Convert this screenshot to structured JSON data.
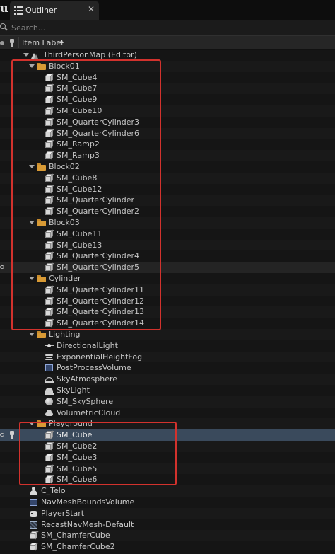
{
  "tab": {
    "title": "Outliner",
    "close": "✕"
  },
  "search": {
    "placeholder": "Search..."
  },
  "header": {
    "column_label": "Item Label"
  },
  "colors": {
    "highlight": "#d2322d",
    "selected_row": "#3a4a5c",
    "folder": "#d89a35"
  },
  "rows": [
    {
      "label": "ThirdPersonMap (Editor)",
      "icon": "map-icon",
      "expanded": true
    },
    {
      "label": "Block01",
      "icon": "folder-icon",
      "expanded": true
    },
    {
      "label": "SM_Cube4",
      "icon": "static-mesh-icon"
    },
    {
      "label": "SM_Cube7",
      "icon": "static-mesh-icon"
    },
    {
      "label": "SM_Cube9",
      "icon": "static-mesh-icon"
    },
    {
      "label": "SM_Cube10",
      "icon": "static-mesh-icon"
    },
    {
      "label": "SM_QuarterCylinder3",
      "icon": "static-mesh-icon"
    },
    {
      "label": "SM_QuarterCylinder6",
      "icon": "static-mesh-icon"
    },
    {
      "label": "SM_Ramp2",
      "icon": "static-mesh-icon"
    },
    {
      "label": "SM_Ramp3",
      "icon": "static-mesh-icon"
    },
    {
      "label": "Block02",
      "icon": "folder-icon",
      "expanded": true
    },
    {
      "label": "SM_Cube8",
      "icon": "static-mesh-icon"
    },
    {
      "label": "SM_Cube12",
      "icon": "static-mesh-icon"
    },
    {
      "label": "SM_QuarterCylinder",
      "icon": "static-mesh-icon"
    },
    {
      "label": "SM_QuarterCylinder2",
      "icon": "static-mesh-icon"
    },
    {
      "label": "Block03",
      "icon": "folder-icon",
      "expanded": true
    },
    {
      "label": "SM_Cube11",
      "icon": "static-mesh-icon"
    },
    {
      "label": "SM_Cube13",
      "icon": "static-mesh-icon"
    },
    {
      "label": "SM_QuarterCylinder4",
      "icon": "static-mesh-icon"
    },
    {
      "label": "SM_QuarterCylinder5",
      "icon": "static-mesh-icon",
      "state": "hover"
    },
    {
      "label": "Cylinder",
      "icon": "folder-icon",
      "expanded": true
    },
    {
      "label": "SM_QuarterCylinder11",
      "icon": "static-mesh-icon"
    },
    {
      "label": "SM_QuarterCylinder12",
      "icon": "static-mesh-icon"
    },
    {
      "label": "SM_QuarterCylinder13",
      "icon": "static-mesh-icon"
    },
    {
      "label": "SM_QuarterCylinder14",
      "icon": "static-mesh-icon"
    },
    {
      "label": "Lighting",
      "icon": "folder-icon",
      "expanded": true
    },
    {
      "label": "DirectionalLight",
      "icon": "directional-light-icon"
    },
    {
      "label": "ExponentialHeightFog",
      "icon": "fog-icon"
    },
    {
      "label": "PostProcessVolume",
      "icon": "volume-icon"
    },
    {
      "label": "SkyAtmosphere",
      "icon": "sky-atmosphere-icon"
    },
    {
      "label": "SkyLight",
      "icon": "sky-light-icon"
    },
    {
      "label": "SM_SkySphere",
      "icon": "sphere-icon"
    },
    {
      "label": "VolumetricCloud",
      "icon": "cloud-icon"
    },
    {
      "label": "Playground",
      "icon": "folder-icon",
      "expanded": true
    },
    {
      "label": "SM_Cube",
      "icon": "static-mesh-icon",
      "state": "selected"
    },
    {
      "label": "SM_Cube2",
      "icon": "static-mesh-icon"
    },
    {
      "label": "SM_Cube3",
      "icon": "static-mesh-icon"
    },
    {
      "label": "SM_Cube5",
      "icon": "static-mesh-icon"
    },
    {
      "label": "SM_Cube6",
      "icon": "static-mesh-icon"
    },
    {
      "label": "C_Telo",
      "icon": "character-icon"
    },
    {
      "label": "NavMeshBoundsVolume",
      "icon": "navmesh-volume-icon"
    },
    {
      "label": "PlayerStart",
      "icon": "player-start-icon"
    },
    {
      "label": "RecastNavMesh-Default",
      "icon": "navmesh-icon"
    },
    {
      "label": "SM_ChamferCube",
      "icon": "chamfer-cube-icon"
    },
    {
      "label": "SM_ChamferCube2",
      "icon": "chamfer-cube-icon"
    }
  ]
}
